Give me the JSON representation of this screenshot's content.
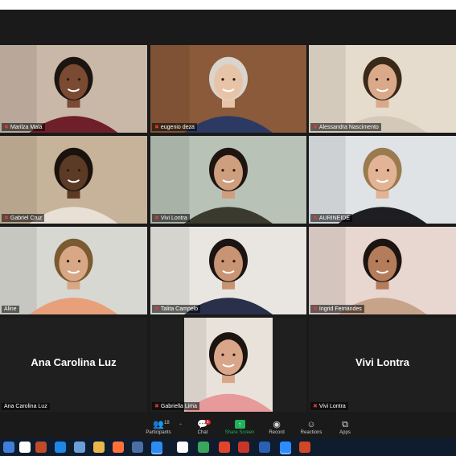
{
  "participants": [
    {
      "name": "Marilza Maia",
      "bg": "#c9b7a8",
      "skin": "#7a4a32",
      "hair": "#1c1410",
      "shirt": "#6e1f2a"
    },
    {
      "name": "eugenio deza",
      "bg": "#8a5a3a",
      "skin": "#e7c4a8",
      "hair": "#d9d4cc",
      "shirt": "#2c3a63"
    },
    {
      "name": "Alessandra Nascimento",
      "bg": "#e6dccd",
      "skin": "#d9a98a",
      "hair": "#3a2818",
      "shirt": "#d4c9b8"
    },
    {
      "name": "Gabriel Cruz",
      "bg": "#c7b39a",
      "skin": "#5b3a26",
      "hair": "#1a120c",
      "shirt": "#e8e0d4"
    },
    {
      "name": "Vivi Lontra",
      "bg": "#b8c2b6",
      "skin": "#cf9e7e",
      "hair": "#1e1510",
      "shirt": "#3a3a2e"
    },
    {
      "name": "AURINEIDE",
      "bg": "#dfe3e6",
      "skin": "#e2b495",
      "hair": "#9a7a4e",
      "shirt": "#1d1d22"
    },
    {
      "name": "Aline",
      "bg": "#d8d8d2",
      "skin": "#d8a886",
      "hair": "#7a5a30",
      "shirt": "#e8a07a"
    },
    {
      "name": "Talita Campelo",
      "bg": "#e9e6e1",
      "skin": "#c99474",
      "hair": "#1a1412",
      "shirt": "#2a2f4a"
    },
    {
      "name": "Ingrid Fernandes",
      "bg": "#e8d6d0",
      "skin": "#b57c5c",
      "hair": "#1c1410",
      "shirt": "#c7a38a"
    }
  ],
  "bottom_row": [
    {
      "display_name": "Ana Carolina Luz",
      "name": "Ana Carolina Luz"
    },
    {
      "name": "Gabriella Lima",
      "bg": "#e9e2da",
      "skin": "#d9a68a",
      "hair": "#1c1410",
      "shirt": "#e79a9a"
    },
    {
      "display_name": "Vivi Lontra",
      "name": "Vivi Lontra"
    }
  ],
  "toolbar": {
    "participants_count": "18",
    "participants_label": "Participants",
    "chat_badge": "1",
    "chat_label": "Chat",
    "share_label": "Share Screen",
    "record_label": "Record",
    "reactions_label": "Reactions",
    "apps_label": "Apps",
    "share_color": "#23b05a"
  },
  "icons": {
    "participants": "people-icon",
    "chat": "speech-bubble-icon",
    "share": "arrow-up-screen-icon",
    "record": "record-circle-icon",
    "reactions": "smiley-plus-icon",
    "apps": "apps-grid-icon"
  },
  "taskbar_colors": [
    "#3f7fd9",
    "#ffffff",
    "#c04a2a",
    "#1e88e5",
    "#6ba0d6",
    "#e8b84a",
    "#ff7139",
    "#4a6fa5",
    "#2d8cf0",
    "#ffffff",
    "#3aa55c",
    "#e0452c",
    "#c8352a",
    "#2b5fb3",
    "#2d8cff",
    "#d24726"
  ]
}
